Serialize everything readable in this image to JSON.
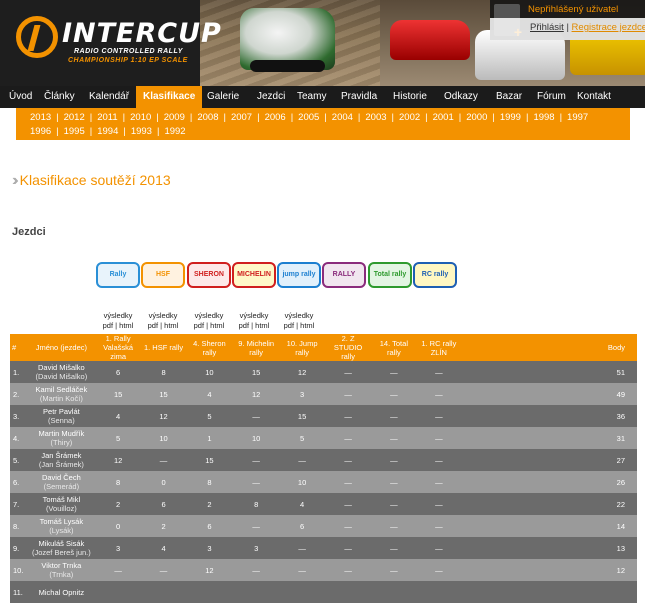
{
  "header": {
    "logo_word": "INTERCUP",
    "logo_tag1": "RADIO CONTROLLED RALLY",
    "logo_tag2": "CHAMPIONSHIP 1:10 EP SCALE",
    "user_name": "Nepřihlášený uživatel",
    "login_label": "Přihlásit",
    "separator": "|",
    "register_label": "Registrace jezdce"
  },
  "nav": [
    {
      "label": "Úvod"
    },
    {
      "label": "Články"
    },
    {
      "label": "Kalendář"
    },
    {
      "label": "Klasifikace",
      "active": true
    },
    {
      "label": "Galerie"
    },
    {
      "label": "Jezdci"
    },
    {
      "label": "Teamy"
    },
    {
      "label": "Pravidla"
    },
    {
      "label": "Historie"
    },
    {
      "label": "Odkazy"
    },
    {
      "label": "Bazar"
    },
    {
      "label": "Fórum"
    },
    {
      "label": "Kontakt"
    }
  ],
  "years_row1": [
    "2013",
    "2012",
    "2011",
    "2010",
    "2009",
    "2008",
    "2007",
    "2006",
    "2005",
    "2004",
    "2003",
    "2002",
    "2001",
    "2000",
    "1999",
    "1998",
    "1997"
  ],
  "years_row2": [
    "1996",
    "1995",
    "1994",
    "1993",
    "1992"
  ],
  "page_title": "Klasifikace soutěží 2013",
  "section_title": "Jezdci",
  "events": [
    {
      "logo": "Rally",
      "color": "#2a8fd6",
      "bg": "#e8f3fb"
    },
    {
      "logo": "HSF",
      "color": "#f39200",
      "bg": "#fff2e0"
    },
    {
      "logo": "SHERON",
      "color": "#d01f1f",
      "bg": "#fde9e9"
    },
    {
      "logo": "MICHELIN",
      "color": "#d01f1f",
      "bg": "#fff8c8"
    },
    {
      "logo": "jump rally",
      "color": "#1c7fd0",
      "bg": "#e1f0fb"
    },
    {
      "logo": "RALLY",
      "color": "#8a2b7c",
      "bg": "#f1e6ef"
    },
    {
      "logo": "Total rally",
      "color": "#2e9a2e",
      "bg": "#e3f5e3"
    },
    {
      "logo": "RC rally ZLÍN",
      "color": "#1e5fb3",
      "bg": "#fff7c2"
    }
  ],
  "results_links": [
    {
      "top": "výsledky",
      "bottom": "pdf | html"
    },
    {
      "top": "výsledky",
      "bottom": "pdf | html"
    },
    {
      "top": "výsledky",
      "bottom": "pdf | html"
    },
    {
      "top": "výsledky",
      "bottom": "pdf | html"
    },
    {
      "top": "výsledky",
      "bottom": "pdf | html"
    }
  ],
  "table": {
    "headers": [
      "#",
      "Jméno (jezdec)",
      "1. Rally Valašská zima",
      "1. HSF rally",
      "4. Sheron rally",
      "9. Michelin rally",
      "10. Jump rally",
      "2. Z STUDIO rally",
      "14. Total rally",
      "1. RC rally ZLÍN",
      "Body"
    ],
    "rows": [
      {
        "n": "1.",
        "name": "David Mišalko",
        "sub": "(David Mišalko)",
        "v": [
          "6",
          "8",
          "10",
          "15",
          "12",
          "—",
          "—",
          "—"
        ],
        "body": "51"
      },
      {
        "n": "2.",
        "name": "Kamil Sedláček",
        "sub": "(Martin Kočí)",
        "v": [
          "15",
          "15",
          "4",
          "12",
          "3",
          "—",
          "—",
          "—"
        ],
        "body": "49"
      },
      {
        "n": "3.",
        "name": "Petr Pavlát",
        "sub": "(Senna)",
        "v": [
          "4",
          "12",
          "5",
          "—",
          "15",
          "—",
          "—",
          "—"
        ],
        "body": "36"
      },
      {
        "n": "4.",
        "name": "Martin Mudřík",
        "sub": "(Thiry)",
        "v": [
          "5",
          "10",
          "1",
          "10",
          "5",
          "—",
          "—",
          "—"
        ],
        "body": "31"
      },
      {
        "n": "5.",
        "name": "Jan Šrámek",
        "sub": "(Jan Šrámek)",
        "v": [
          "12",
          "—",
          "15",
          "—",
          "—",
          "—",
          "—",
          "—"
        ],
        "body": "27"
      },
      {
        "n": "6.",
        "name": "David Čech",
        "sub": "(Semerád)",
        "v": [
          "8",
          "0",
          "8",
          "—",
          "10",
          "—",
          "—",
          "—"
        ],
        "body": "26"
      },
      {
        "n": "7.",
        "name": "Tomáš Mikl",
        "sub": "(Vouilloz)",
        "v": [
          "2",
          "6",
          "2",
          "8",
          "4",
          "—",
          "—",
          "—"
        ],
        "body": "22"
      },
      {
        "n": "8.",
        "name": "Tomáš Lysák",
        "sub": "(Lysák)",
        "v": [
          "0",
          "2",
          "6",
          "—",
          "6",
          "—",
          "—",
          "—"
        ],
        "body": "14"
      },
      {
        "n": "9.",
        "name": "Mikuláš Sisák",
        "sub": "(Jozef Bereš jun.)",
        "v": [
          "3",
          "4",
          "3",
          "3",
          "—",
          "—",
          "—",
          "—"
        ],
        "body": "13"
      },
      {
        "n": "10.",
        "name": "Viktor Trnka",
        "sub": "(Trnka)",
        "v": [
          "—",
          "—",
          "12",
          "—",
          "—",
          "—",
          "—",
          "—"
        ],
        "body": "12"
      },
      {
        "n": "11.",
        "name": "Michal Opnitz",
        "sub": "",
        "v": [
          "",
          "",
          "",
          "",
          "",
          "",
          "",
          ""
        ],
        "body": ""
      }
    ]
  }
}
